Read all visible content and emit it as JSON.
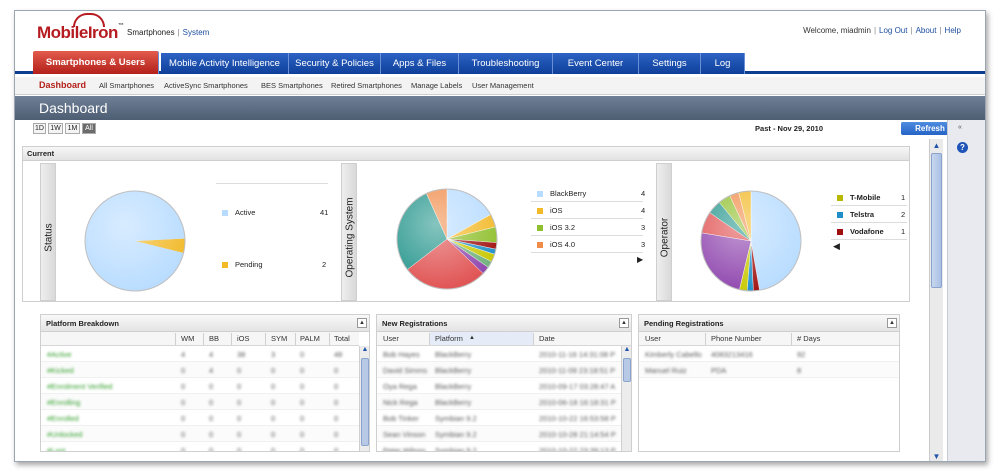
{
  "header": {
    "logo": "MobileIron",
    "app_current": "Smartphones",
    "app_other": "System",
    "welcome": "Welcome, miadmin",
    "logout": "Log Out",
    "about": "About",
    "help": "Help"
  },
  "nav": {
    "tabs": [
      "Smartphones & Users",
      "Mobile Activity Intelligence",
      "Security & Policies",
      "Apps & Files",
      "Troubleshooting",
      "Event Center",
      "Settings",
      "Log"
    ]
  },
  "subnav": {
    "items": [
      "Dashboard",
      "All Smartphones",
      "ActiveSync Smartphones",
      "BES Smartphones",
      "Retired Smartphones",
      "Manage Labels",
      "User Management"
    ]
  },
  "page": {
    "title": "Dashboard",
    "ranges": [
      "1D",
      "1W",
      "1M",
      "All"
    ],
    "active_range": "All",
    "past": "Past - Nov 29, 2010",
    "refresh": "Refresh"
  },
  "current": {
    "title": "Current",
    "status": {
      "label": "Status",
      "legend": [
        {
          "name": "Active",
          "count": "41",
          "color": "#b8dcff"
        },
        {
          "name": "Pending",
          "count": "2",
          "color": "#f2b928"
        }
      ]
    },
    "os": {
      "label": "Operating System",
      "legend": [
        {
          "name": "BlackBerry",
          "count": "4",
          "color": "#b8dcff"
        },
        {
          "name": "iOS",
          "count": "4",
          "color": "#f2b928"
        },
        {
          "name": "iOS 3.2",
          "count": "3",
          "color": "#8fbf2c"
        },
        {
          "name": "iOS 4.0",
          "count": "3",
          "color": "#f08c4a"
        }
      ]
    },
    "operator": {
      "label": "Operator",
      "legend": [
        {
          "name": "T-Mobile",
          "count": "1",
          "color": "#b8b800"
        },
        {
          "name": "Telstra",
          "count": "2",
          "color": "#1e8fc9"
        },
        {
          "name": "Vodafone",
          "count": "1",
          "color": "#a01010"
        }
      ]
    }
  },
  "platform": {
    "title": "Platform Breakdown",
    "columns": [
      "WM",
      "BB",
      "iOS",
      "SYM",
      "PALM",
      "Total"
    ],
    "rows": [
      {
        "label": "#Active",
        "vals": [
          "4",
          "4",
          "38",
          "3",
          "0",
          "48"
        ]
      },
      {
        "label": "#Kicked",
        "vals": [
          "0",
          "4",
          "0",
          "0",
          "0",
          "0"
        ]
      },
      {
        "label": "#Enrolment Verified",
        "vals": [
          "0",
          "0",
          "0",
          "0",
          "0",
          "0"
        ]
      },
      {
        "label": "#Enrolling",
        "vals": [
          "0",
          "0",
          "0",
          "0",
          "0",
          "0"
        ]
      },
      {
        "label": "#Enrolled",
        "vals": [
          "0",
          "0",
          "0",
          "0",
          "0",
          "0"
        ]
      },
      {
        "label": "#Unlocked",
        "vals": [
          "0",
          "0",
          "0",
          "0",
          "0",
          "0"
        ]
      },
      {
        "label": "#Lost",
        "vals": [
          "0",
          "0",
          "0",
          "0",
          "0",
          "0"
        ]
      }
    ]
  },
  "newreg": {
    "title": "New Registrations",
    "columns": [
      "User",
      "Platform",
      "Date"
    ],
    "rows": [
      {
        "user": "Bob Hayes",
        "platform": "BlackBerry",
        "date": "2010-11-16 14:31:08 P"
      },
      {
        "user": "David Simms",
        "platform": "BlackBerry",
        "date": "2010-11-09 23:18:51 P"
      },
      {
        "user": "Oya Rega",
        "platform": "BlackBerry",
        "date": "2010-09-17 03:28:47 A"
      },
      {
        "user": "Nick Rega",
        "platform": "BlackBerry",
        "date": "2010-06-18 16:18:31 P"
      },
      {
        "user": "Bob Tinker",
        "platform": "Symbian 9.2",
        "date": "2010-10-22 16:53:58 P"
      },
      {
        "user": "Sean Vinson",
        "platform": "Symbian 9.2",
        "date": "2010-10-28 21:14:54 P"
      },
      {
        "user": "Peter Wilson",
        "platform": "Symbian 9.2",
        "date": "2010-10-22 23:39:13 P"
      }
    ]
  },
  "pendreg": {
    "title": "Pending Registrations",
    "columns": [
      "User",
      "Phone Number",
      "# Days"
    ],
    "rows": [
      {
        "user": "Kimberly Cabello",
        "phone": "4083213416",
        "days": "92"
      },
      {
        "user": "Manuel Ruiz",
        "phone": "PDA",
        "days": "8"
      }
    ]
  }
}
